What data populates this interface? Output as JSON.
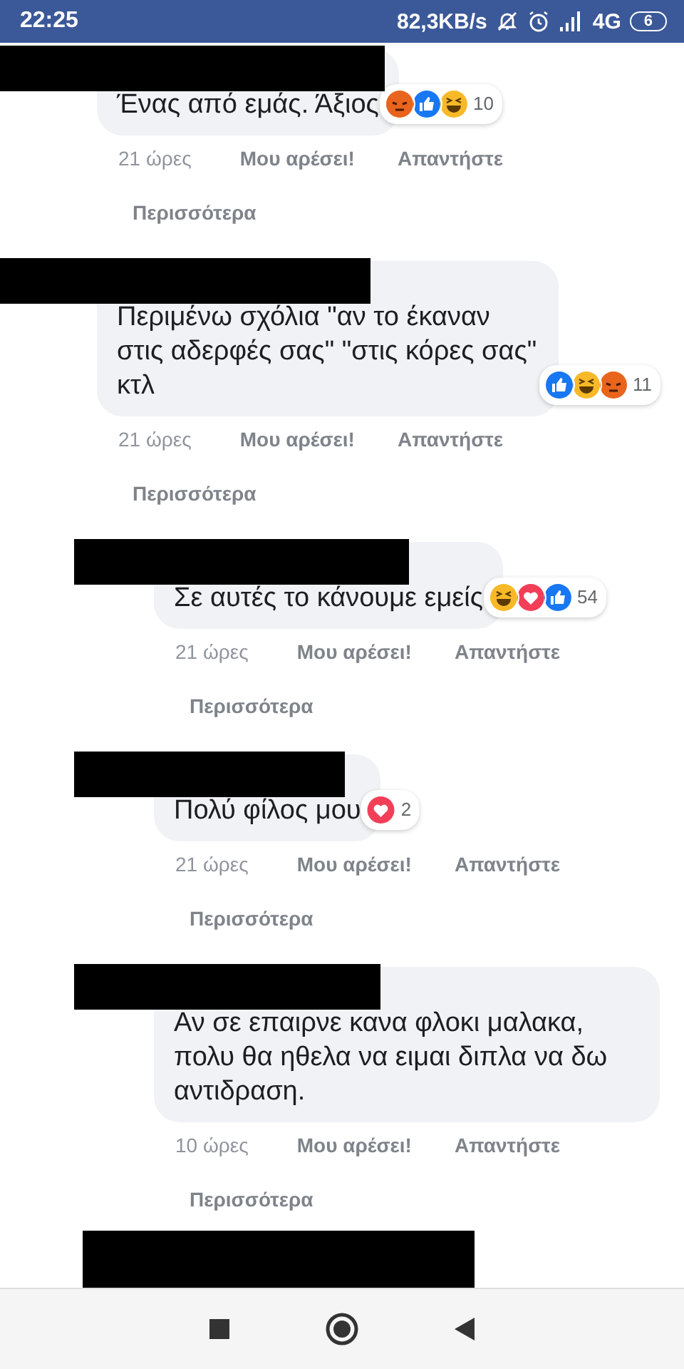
{
  "status_bar": {
    "time": "22:25",
    "speed": "82,3KB/s",
    "network": "4G",
    "battery": "6"
  },
  "comments": [
    {
      "redacted": true,
      "text": "Ένας από εμάς. Άξιος",
      "reactions": [
        {
          "kind": "angry"
        },
        {
          "kind": "like"
        },
        {
          "kind": "haha"
        }
      ],
      "reaction_count": "10",
      "time": "21 ώρες",
      "like": "Μου αρέσει!",
      "reply": "Απαντήστε",
      "more": "Περισσότερα"
    },
    {
      "redacted": true,
      "text": "Περιμένω σχόλια \"αν το έκαναν στις αδερφές σας\" \"στις κόρες σας\" κτλ",
      "reactions": [
        {
          "kind": "like"
        },
        {
          "kind": "haha"
        },
        {
          "kind": "angry"
        }
      ],
      "reaction_count": "11",
      "time": "21 ώρες",
      "like": "Μου αρέσει!",
      "reply": "Απαντήστε",
      "more": "Περισσότερα",
      "children": [
        {
          "redacted": true,
          "text": "Σε αυτές το κάνουμε εμείς",
          "reactions": [
            {
              "kind": "haha"
            },
            {
              "kind": "love"
            },
            {
              "kind": "like"
            }
          ],
          "reaction_count": "54",
          "time": "21 ώρες",
          "like": "Μου αρέσει!",
          "reply": "Απαντήστε",
          "more": "Περισσότερα"
        },
        {
          "redacted": true,
          "text": "Πολύ φίλος μου",
          "reactions": [
            {
              "kind": "love"
            }
          ],
          "reaction_count": "2",
          "time": "21 ώρες",
          "like": "Μου αρέσει!",
          "reply": "Απαντήστε",
          "more": "Περισσότερα"
        },
        {
          "redacted": true,
          "text": "Αν σε επαιρνε κανα φλοκι μαλακα, πολυ θα ηθελα να ειμαι διπλα να δω αντιδραση.",
          "time": "10 ώρες",
          "like": "Μου αρέσει!",
          "reply": "Απαντήστε",
          "more": "Περισσότερα"
        }
      ]
    }
  ],
  "next_comment": {
    "redacted": true
  }
}
